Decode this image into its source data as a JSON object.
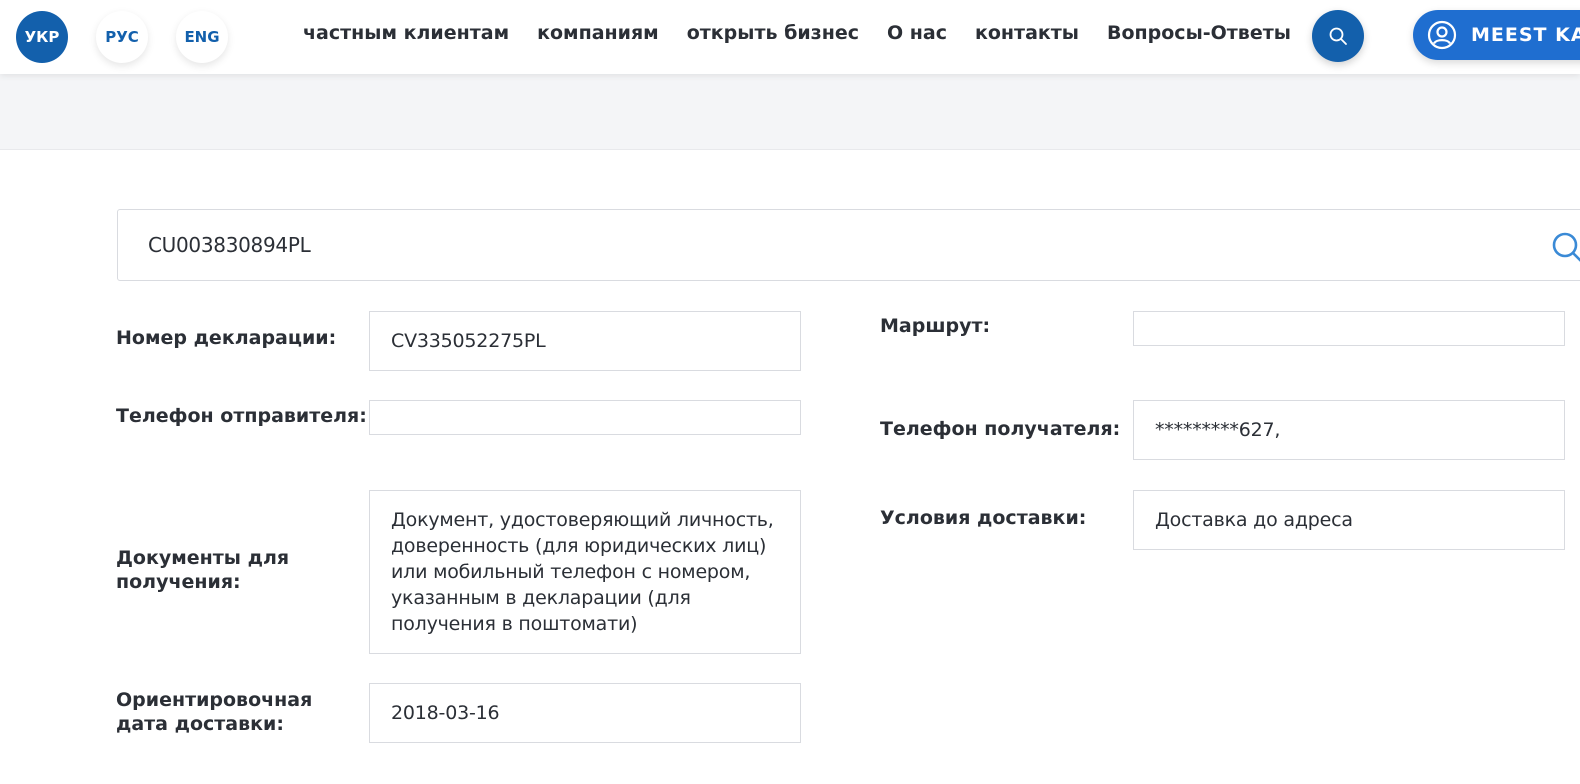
{
  "header": {
    "languages": [
      {
        "label": "УКР",
        "active": true
      },
      {
        "label": "РУС",
        "active": false
      },
      {
        "label": "ENG",
        "active": false
      }
    ],
    "nav": [
      "частным клиентам",
      "компаниям",
      "открыть бизнес",
      "О нас",
      "контакты",
      "Вопросы-Ответы"
    ],
    "search_icon": "search-icon",
    "cabinet_label": "MEEST KA",
    "cabinet_icon": "user-circle-icon"
  },
  "tracking": {
    "value": "CU003830894PL",
    "search_icon": "search-icon"
  },
  "form": {
    "declaration_label": "Номер декларации:",
    "declaration_value": "CV335052275PL",
    "route_label": "Маршрут:",
    "route_value": "",
    "sender_phone_label": "Телефон отправителя:",
    "sender_phone_value": "",
    "recipient_phone_label": "Телефон получателя:",
    "recipient_phone_value": "*********627,",
    "documents_label": "Документы для получения:",
    "documents_value": "Документ, удостоверяющий личность, доверенность (для юридических лиц) или мобильный телефон с номером, указанным в декларации (для получения в поштомати)",
    "delivery_terms_label": "Условия доставки:",
    "delivery_terms_value": "Доставка до адреса",
    "eta_label": "Ориентировочная дата доставки:",
    "eta_value": "2018-03-16"
  },
  "colors": {
    "brand_dark": "#1360ac",
    "brand_light": "#1f6ed0",
    "icon_accent": "#3a8ad6"
  }
}
